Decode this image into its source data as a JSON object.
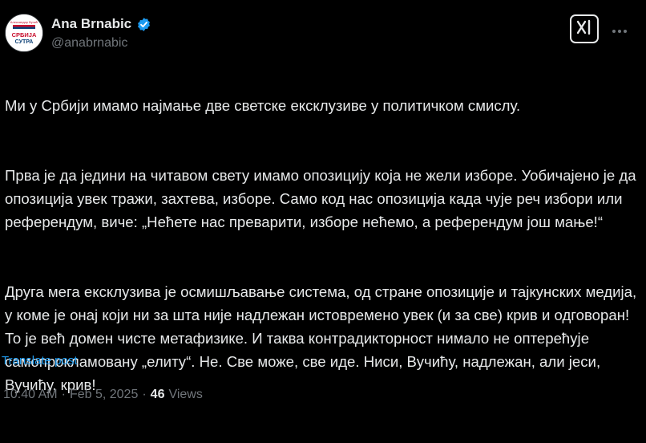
{
  "author": {
    "display_name": "Ana Brnabic",
    "handle": "@anabrnabic",
    "avatar_text_top": "Александар Вучић",
    "avatar_text_main": "СРБИЈА",
    "avatar_text_sub": "СУТРА"
  },
  "post": {
    "paragraphs": [
      "Ми у Србији имамо најмање две светске ексклузиве у политичком смислу.",
      "Прва је да једини на читавом свету имамо опозицију која не жели изборе. Уобичајено је да опозиција увек тражи, захтева, изборе. Само код нас опозиција када чује реч избори или референдум, виче: „Нећете нас преварити, изборе нећемо, а референдум још мање!“",
      "Друга мега ексклузива је осмишљавање система, од стране опозиције и тајкунских медија, у коме је онај који ни за шта није надлежан истовремено увек (и за све) крив и одговоран! То је већ домен чисте метафизике. И таква контрадикторност нимало не оптерећује самопрокламовану „елиту“. Не. Све може, све иде. Ниси, Вучићу, надлежан, али јеси, Вучићу, крив!"
    ],
    "translate_label": "Translate post",
    "time": "10:40 AM",
    "date": "Feb 5, 2025",
    "separator": "·",
    "views_count": "46",
    "views_label": "Views"
  },
  "icons": {
    "verified": "verified-badge-icon",
    "grok": "grok-icon",
    "more": "more-options-icon"
  },
  "colors": {
    "background": "#000000",
    "text": "#e7e9ea",
    "secondary": "#71767b",
    "link": "#1d9bf0",
    "verified": "#1d9bf0"
  }
}
